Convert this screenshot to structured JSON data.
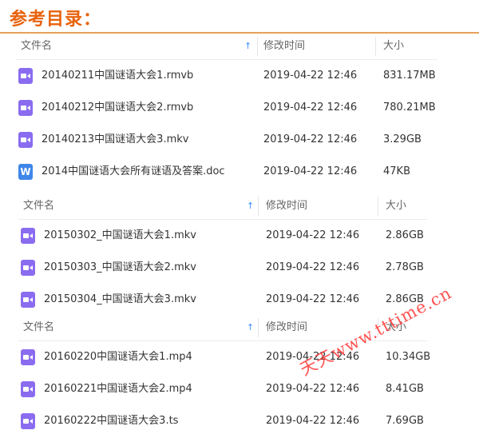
{
  "page_title": "参考目录：",
  "watermark": "天天www.tttime.cn",
  "colors": {
    "title": "#e8620c",
    "video_icon": "#8a6cf0",
    "word_icon": "#3f86ea",
    "sort_arrow": "#3b8cff",
    "watermark": "#ff3b3b"
  },
  "sections": [
    {
      "headers": {
        "name": "文件名",
        "modified": "修改时间",
        "size": "大小"
      },
      "files": [
        {
          "name": "20140211中国谜语大会1.rmvb",
          "modified": "2019-04-22 12:46",
          "size": "831.17MB",
          "icon": "video-icon"
        },
        {
          "name": "20140212中国谜语大会2.rmvb",
          "modified": "2019-04-22 12:46",
          "size": "780.21MB",
          "icon": "video-icon"
        },
        {
          "name": "20140213中国谜语大会3.mkv",
          "modified": "2019-04-22 12:46",
          "size": "3.29GB",
          "icon": "video-icon"
        },
        {
          "name": "2014中国谜语大会所有谜语及答案.doc",
          "modified": "2019-04-22 12:46",
          "size": "47KB",
          "icon": "word-icon",
          "icon_letter": "W"
        }
      ]
    },
    {
      "headers": {
        "name": "文件名",
        "modified": "修改时间",
        "size": "大小"
      },
      "files": [
        {
          "name": "20150302_中国谜语大会1.mkv",
          "modified": "2019-04-22 12:46",
          "size": "2.86GB",
          "icon": "video-icon"
        },
        {
          "name": "20150303_中国谜语大会2.mkv",
          "modified": "2019-04-22 12:46",
          "size": "2.78GB",
          "icon": "video-icon"
        },
        {
          "name": "20150304_中国谜语大会3.mkv",
          "modified": "2019-04-22 12:46",
          "size": "2.86GB",
          "icon": "video-icon"
        }
      ]
    },
    {
      "headers": {
        "name": "文件名",
        "modified": "修改时间",
        "size": "大小"
      },
      "files": [
        {
          "name": "20160220中国谜语大会1.mp4",
          "modified": "2019-04-22 12:46",
          "size": "10.34GB",
          "icon": "video-icon"
        },
        {
          "name": "20160221中国谜语大会2.mp4",
          "modified": "2019-04-22 12:46",
          "size": "8.41GB",
          "icon": "video-icon"
        },
        {
          "name": "20160222中国谜语大会3.ts",
          "modified": "2019-04-22 12:46",
          "size": "7.69GB",
          "icon": "video-icon"
        }
      ]
    }
  ]
}
